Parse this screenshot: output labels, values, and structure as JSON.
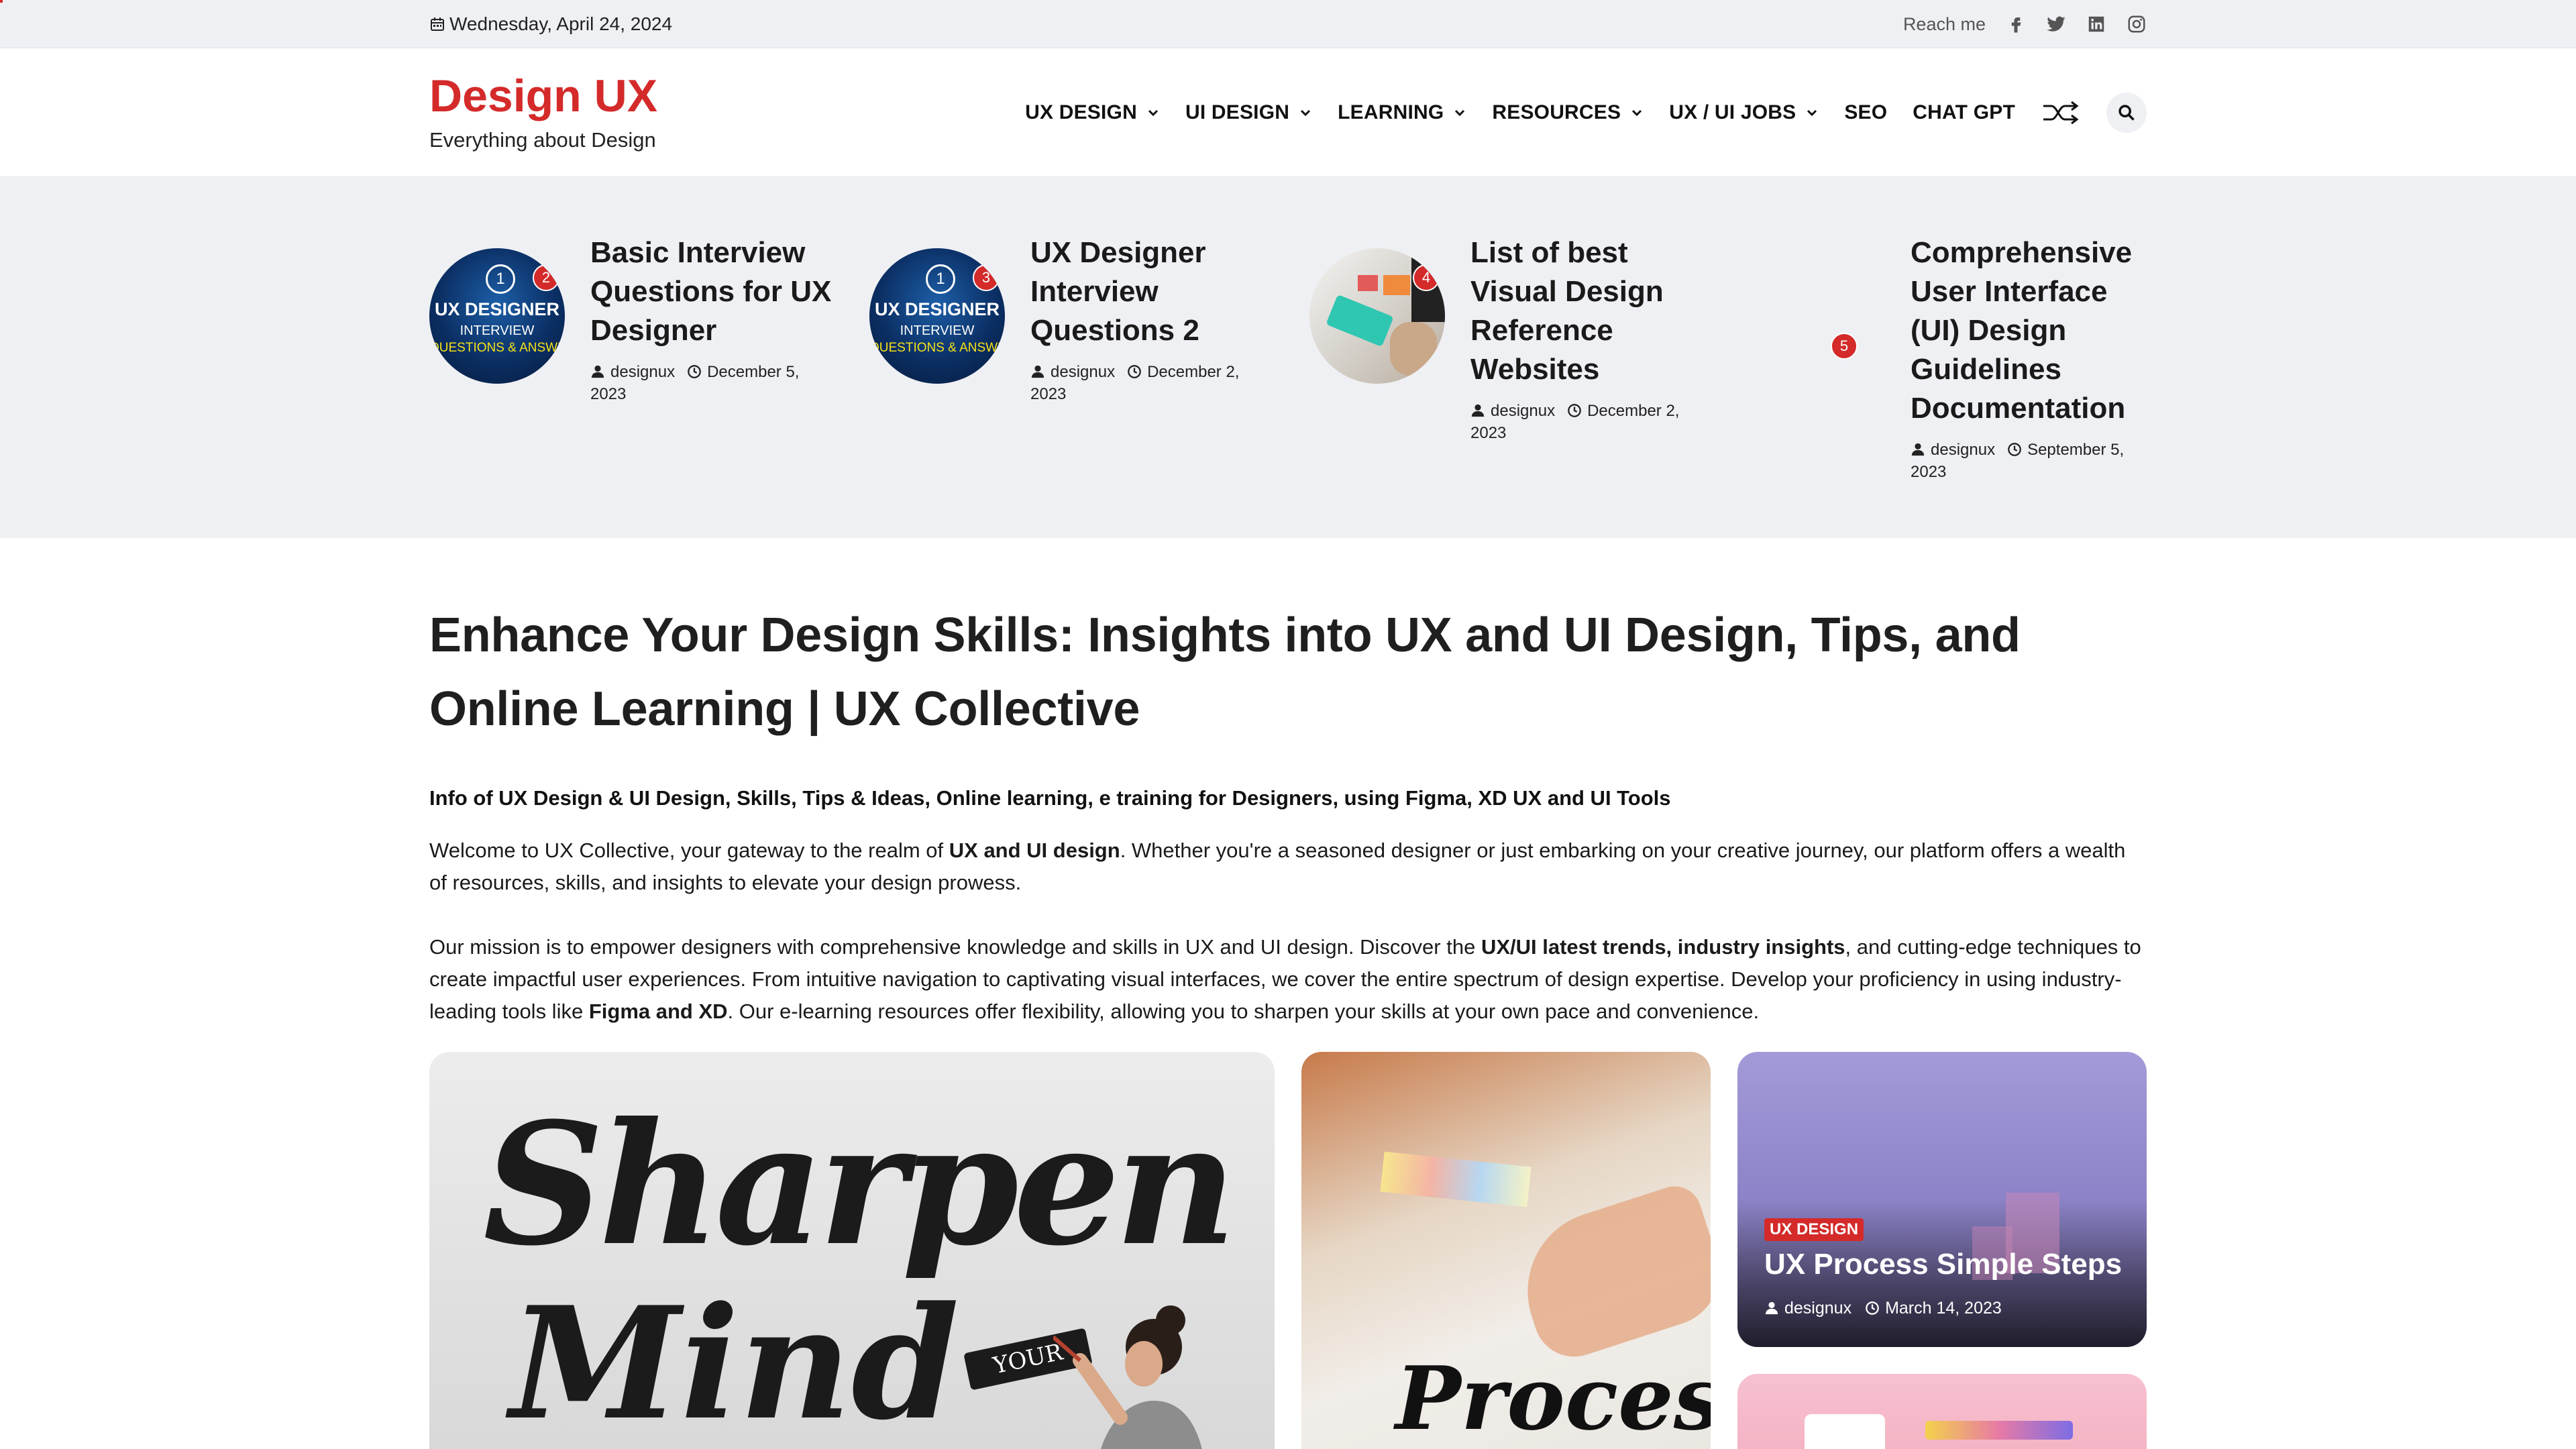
{
  "topbar": {
    "date": "Wednesday, April 24, 2024",
    "reach": "Reach me",
    "social_icons": [
      "facebook-icon",
      "twitter-icon",
      "linkedin-icon",
      "instagram-icon"
    ]
  },
  "header": {
    "brand": "Design UX",
    "tagline": "Everything about Design",
    "nav": [
      {
        "label": "UX DESIGN",
        "dropdown": true
      },
      {
        "label": "UI DESIGN",
        "dropdown": true
      },
      {
        "label": "LEARNING",
        "dropdown": true
      },
      {
        "label": "RESOURCES",
        "dropdown": true
      },
      {
        "label": "UX / UI JOBS",
        "dropdown": true
      },
      {
        "label": "SEO",
        "dropdown": false
      },
      {
        "label": "CHAT GPT",
        "dropdown": false
      }
    ]
  },
  "trending": [
    {
      "rank": "2",
      "title": "Basic Interview Questions for UX Designer",
      "author": "designux",
      "date": "December 5, 2023",
      "thumb": {
        "num": "1",
        "line1": "UX DESIGNER",
        "line2": "INTERVIEW",
        "line3": "QUESTIONS & ANSWERS"
      }
    },
    {
      "rank": "3",
      "title": "UX Designer Interview Questions 2",
      "author": "designux",
      "date": "December 2, 2023",
      "thumb": {
        "num": "1",
        "line1": "UX DESIGNER",
        "line2": "INTERVIEW",
        "line3": "QUESTIONS & ANSWERS"
      }
    },
    {
      "rank": "4",
      "title": "List of best Visual Design Reference Websites",
      "author": "designux",
      "date": "December 2, 2023"
    },
    {
      "rank": "5",
      "title": "Comprehensive User Interface (UI) Design Guidelines Documentation",
      "author": "designux",
      "date": "September 5, 2023"
    }
  ],
  "main": {
    "title": "Enhance Your Design Skills: Insights into UX and UI Design, Tips, and Online Learning | UX Collective",
    "subhead": "Info of UX Design & UI Design, Skills, Tips & Ideas, Online learning, e training for Designers, using Figma, XD UX and UI Tools",
    "p1": {
      "a": "Welcome to UX Collective, your gateway to the realm of ",
      "b": "UX and UI design",
      "c": ". Whether you're a seasoned designer or just embarking on your creative journey, our platform offers a wealth of resources, skills, and insights to elevate your design prowess."
    },
    "p2": {
      "a": "Our mission is to empower designers with comprehensive knowledge and skills in UX and UI design. Discover the ",
      "b": "UX/UI latest trends, industry insights",
      "c": ", and cutting-edge techniques to create impactful user experiences. From intuitive navigation to captivating visual interfaces, we cover the entire spectrum of design expertise. Develop your proficiency in using industry-leading tools like ",
      "d": "Figma and XD",
      "e": ". Our e-learning resources offer flexibility, allowing you to sharpen your skills at your own pace and convenience."
    }
  },
  "cards": {
    "big": {
      "art1": "Sharpen",
      "art2": "Mind",
      "art3": "YOUR"
    },
    "mid": {
      "art": "Proces"
    },
    "side": {
      "category": "UX DESIGN",
      "title": "UX Process Simple Steps",
      "author": "designux",
      "date": "March 14, 2023"
    }
  },
  "colors": {
    "accent": "#d42a2a",
    "strip_bg": "#eff0f4"
  }
}
